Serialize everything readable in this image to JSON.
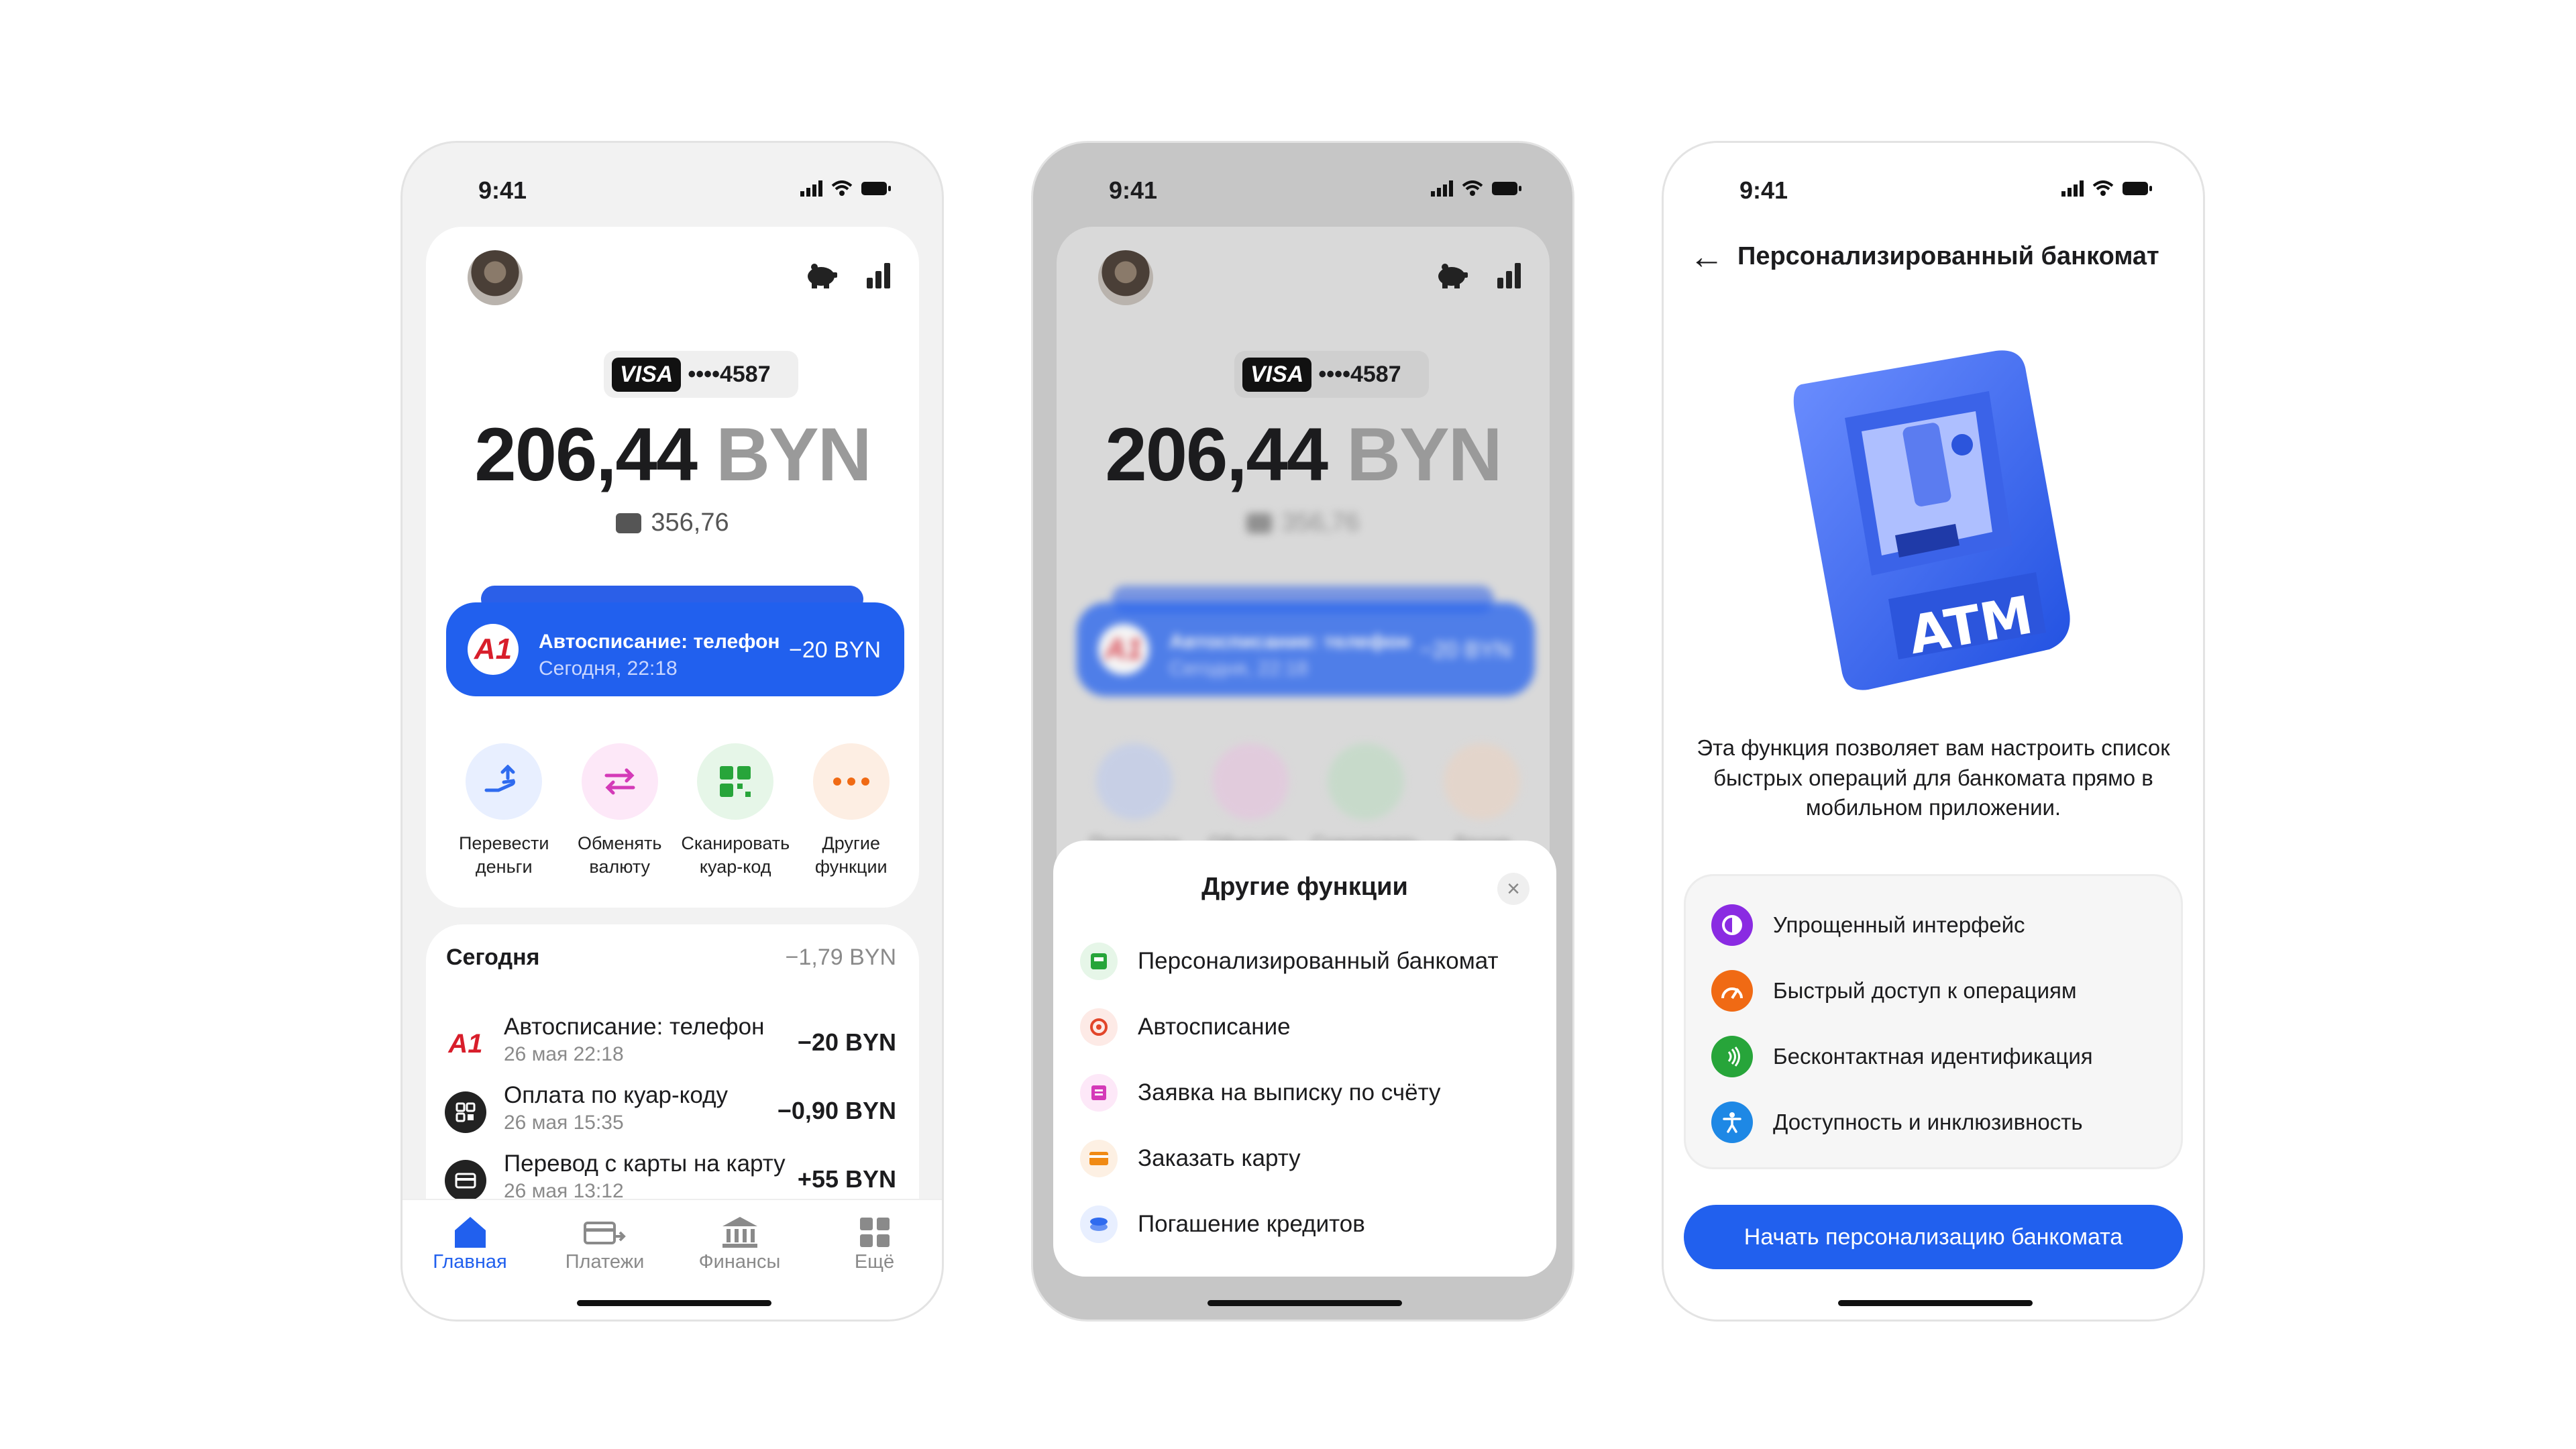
{
  "status_time": "9:41",
  "home": {
    "card_brand": "VISA",
    "card_number": "••••4587",
    "balance_amount": "206,44",
    "balance_currency": "BYN",
    "sub_balance": "356,76",
    "promo": {
      "logo": "A1",
      "title": "Автосписание: телефон",
      "time": "Сегодня, 22:18",
      "amount": "−20 BYN"
    },
    "quick_actions": [
      {
        "label": "Перевести деньги",
        "icon": "hand-transfer-icon",
        "color": "#2f6bef",
        "bg": "#e8efff"
      },
      {
        "label": "Обменять валюту",
        "icon": "exchange-arrows-icon",
        "color": "#d43ab8",
        "bg": "#fde8f8"
      },
      {
        "label": "Сканировать куар-код",
        "icon": "qr-code-icon",
        "color": "#27a53a",
        "bg": "#e6f6e8"
      },
      {
        "label": "Другие функции",
        "icon": "more-dots-icon",
        "color": "#f06a14",
        "bg": "#fdeee3"
      }
    ],
    "today": {
      "label": "Сегодня",
      "total": "−1,79 BYN"
    },
    "transactions": [
      {
        "title": "Автосписание: телефон",
        "date": "26 мая 22:18",
        "amount": "−20 BYN",
        "icon": "a1-logo-icon"
      },
      {
        "title": "Оплата по куар-коду",
        "date": "26 мая 15:35",
        "amount": "−0,90 BYN",
        "icon": "qr-code-icon"
      },
      {
        "title": "Перевод с карты на карту",
        "date": "26 мая 13:12",
        "amount": "+55 BYN",
        "icon": "card-icon"
      }
    ],
    "tabs": [
      {
        "label": "Главная",
        "icon": "home-icon"
      },
      {
        "label": "Платежи",
        "icon": "payments-icon"
      },
      {
        "label": "Финансы",
        "icon": "bank-icon"
      },
      {
        "label": "Ещё",
        "icon": "grid-icon"
      }
    ]
  },
  "sheet": {
    "title": "Другие функции",
    "items": [
      {
        "label": "Персонализированный банкомат",
        "icon": "atm-icon",
        "color": "#27a53a",
        "bg": "#e6f6e8"
      },
      {
        "label": "Автосписание",
        "icon": "autopay-icon",
        "color": "#e2452a",
        "bg": "#fdeae6"
      },
      {
        "label": "Заявка на выписку по счёту",
        "icon": "statement-icon",
        "color": "#d43ab8",
        "bg": "#fde8f8"
      },
      {
        "label": "Заказать карту",
        "icon": "order-card-icon",
        "color": "#f08a14",
        "bg": "#fdf0e3"
      },
      {
        "label": "Погашение кредитов",
        "icon": "loan-icon",
        "color": "#2f6bef",
        "bg": "#e8efff"
      }
    ]
  },
  "atm": {
    "title": "Персонализированный банкомат",
    "image_text": "ATM",
    "description": "Эта функция позволяет вам настроить список быстрых операций для банкомата прямо в мобильном приложении.",
    "features": [
      {
        "label": "Упрощенный интерфейс",
        "icon": "contrast-icon",
        "color": "#8a2be2"
      },
      {
        "label": "Быстрый доступ к операциям",
        "icon": "speedometer-icon",
        "color": "#f06a14"
      },
      {
        "label": "Бесконтактная идентификация",
        "icon": "contactless-icon",
        "color": "#27a53a"
      },
      {
        "label": "Доступность и инклюзивность",
        "icon": "accessibility-icon",
        "color": "#1e88e5"
      }
    ],
    "cta": "Начать персонализацию банкомата"
  }
}
